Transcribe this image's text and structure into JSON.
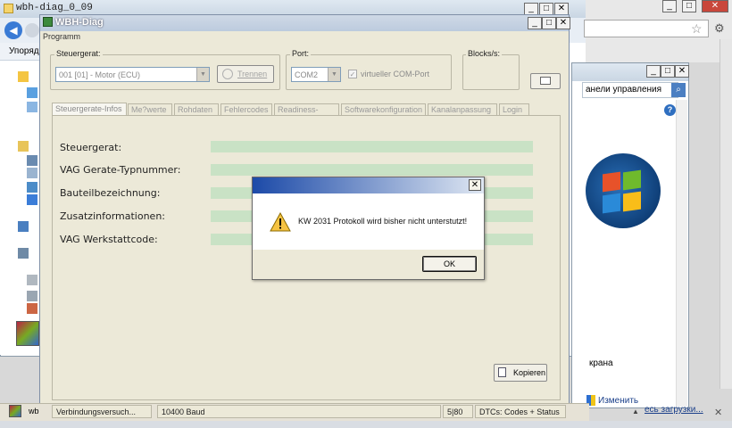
{
  "background_window": {
    "title": "wbh-diag_0_09",
    "menu_label": "Упоряд"
  },
  "control_panel": {
    "address_text": "анели управления",
    "text_line1": "крана",
    "link_label": "Изменить"
  },
  "wbh": {
    "title": "WBH-Diag",
    "menu": "Programm",
    "steuergeraet_group": "Steuergerat:",
    "steuergeraet_value": "001 [01] - Motor (ECU)",
    "trennen_label": "Trennen",
    "port_group": "Port:",
    "port_value": "COM2",
    "virtual_port_label": "virtueller COM-Port",
    "virtual_port_checked": true,
    "blocks_label": "Blocks/s:",
    "kopieren_label": "Kopieren",
    "tabs": [
      {
        "label": "Steuergerate-Infos",
        "active": true
      },
      {
        "label": "Me?werte",
        "active": false
      },
      {
        "label": "Rohdaten",
        "active": false
      },
      {
        "label": "Fehlercodes",
        "active": false
      },
      {
        "label": "Readiness-Code",
        "active": false
      },
      {
        "label": "Softwarekonfiguration",
        "active": false
      },
      {
        "label": "Kanalanpassung",
        "active": false
      },
      {
        "label": "Login",
        "active": false
      }
    ],
    "fields": [
      {
        "label": "Steuergerat:",
        "value": ""
      },
      {
        "label": "VAG Gerate-Typnummer:",
        "value": ""
      },
      {
        "label": "Bauteilbezeichnung:",
        "value": ""
      },
      {
        "label": "Zusatzinformationen:",
        "value": ""
      },
      {
        "label": "VAG Werkstattcode:",
        "value": ""
      }
    ]
  },
  "statusbar": {
    "connection": "Verbindungsversuch...",
    "baud": "10400 Baud",
    "counter": "5|80",
    "dtcs": "DTCs: Codes + Status",
    "taskbar_fragment": "wb",
    "tray_link": "есь загрузки..."
  },
  "dialog": {
    "message": "KW 2031 Protokoll wird bisher nicht unterstutzt!",
    "ok_label": "OK"
  },
  "colors": {
    "window_face": "#ece9d8",
    "field_bar": "#c9e2c5",
    "dialog_title": "#1c4aa8"
  }
}
